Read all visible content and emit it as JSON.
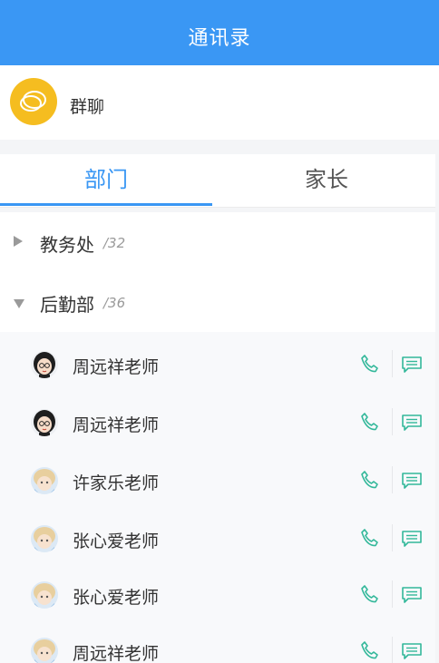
{
  "header": {
    "title": "通讯录"
  },
  "group_chat": {
    "label": "群聊"
  },
  "tabs": [
    {
      "label": "部门",
      "active": true
    },
    {
      "label": "家长",
      "active": false
    }
  ],
  "departments": [
    {
      "name": "教务处",
      "count": "/32",
      "expanded": false
    },
    {
      "name": "后勤部",
      "count": "/36",
      "expanded": true
    }
  ],
  "members": [
    {
      "name": "周远祥老师",
      "avatar": "female-glasses"
    },
    {
      "name": "周远祥老师",
      "avatar": "female-glasses"
    },
    {
      "name": "许家乐老师",
      "avatar": "blond-boy"
    },
    {
      "name": "张心爱老师",
      "avatar": "blond-boy"
    },
    {
      "name": "张心爱老师",
      "avatar": "blond-boy"
    },
    {
      "name": "周远祥老师",
      "avatar": "blond-boy"
    }
  ],
  "icons": {
    "call": "phone-icon",
    "message": "message-icon",
    "group": "chat-bubble-icon"
  },
  "colors": {
    "primary": "#3a97f4",
    "accent_green": "#33b89a",
    "group_avatar": "#f5bd20"
  }
}
